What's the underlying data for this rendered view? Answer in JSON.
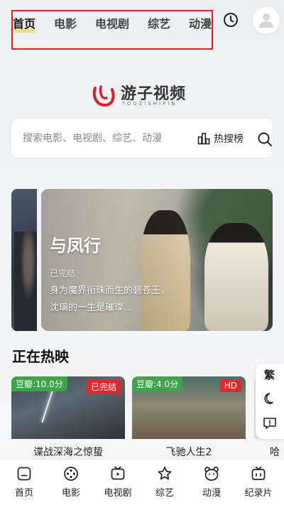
{
  "top_nav": {
    "tabs": [
      "首页",
      "电影",
      "电视剧",
      "综艺",
      "动漫"
    ],
    "active_tab": "首页",
    "icons": {
      "history": "clock-icon",
      "avatar": "user-icon"
    }
  },
  "logo": {
    "name": "游子视频",
    "subtitle": "YOUZISHIPIN"
  },
  "search": {
    "placeholder": "搜索电影、电视剧、综艺、动漫",
    "hot_label": "热搜榜"
  },
  "banner": {
    "title": "与凤行",
    "status": "已完结",
    "description": "身为魔界衔珠而生的碧苍王，沈璃的一生是璀璨…"
  },
  "section": {
    "title": "正在热映"
  },
  "cards": [
    {
      "score": "豆瓣:10.0分",
      "tag": "已完结",
      "title": "谍战深海之惊蛰"
    },
    {
      "score": "豆瓣:4.0分",
      "tag": "HD",
      "title": "飞驰人生2"
    },
    {
      "title": "哈"
    }
  ],
  "side_tools": {
    "traditional": "繁"
  },
  "bottom_nav": [
    "首页",
    "电影",
    "电视剧",
    "综艺",
    "动漫",
    "纪录片"
  ],
  "colors": {
    "accent_red": "#d8202c",
    "score_green": "#3ca54a",
    "tag_red": "#e42828"
  }
}
